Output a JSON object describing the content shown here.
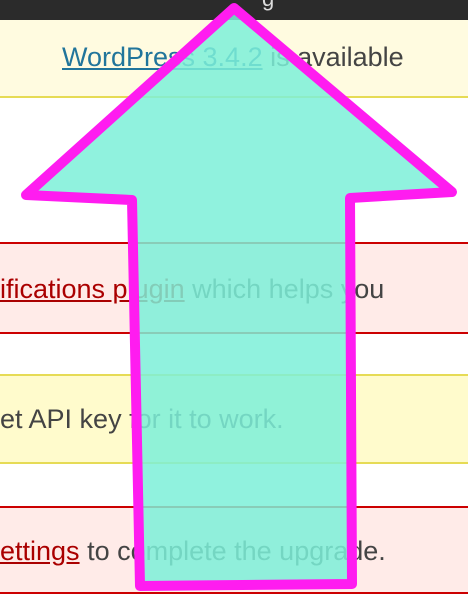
{
  "topbar": {
    "partial_title": "g"
  },
  "update_nag": {
    "link_text": "WordPress 3.4.2",
    "after_text": " is available"
  },
  "notice1": {
    "link_text": "ifications plugin",
    "after_text": " which helps you"
  },
  "notice2": {
    "text": "et API key for it to work."
  },
  "notice3": {
    "link_text": "ettings",
    "after_text": " to complete the upgrade."
  },
  "overlay": {
    "arrow_fill": "#7df0d8",
    "arrow_stroke": "#ff1cf0",
    "icon": "up-arrow-icon"
  }
}
